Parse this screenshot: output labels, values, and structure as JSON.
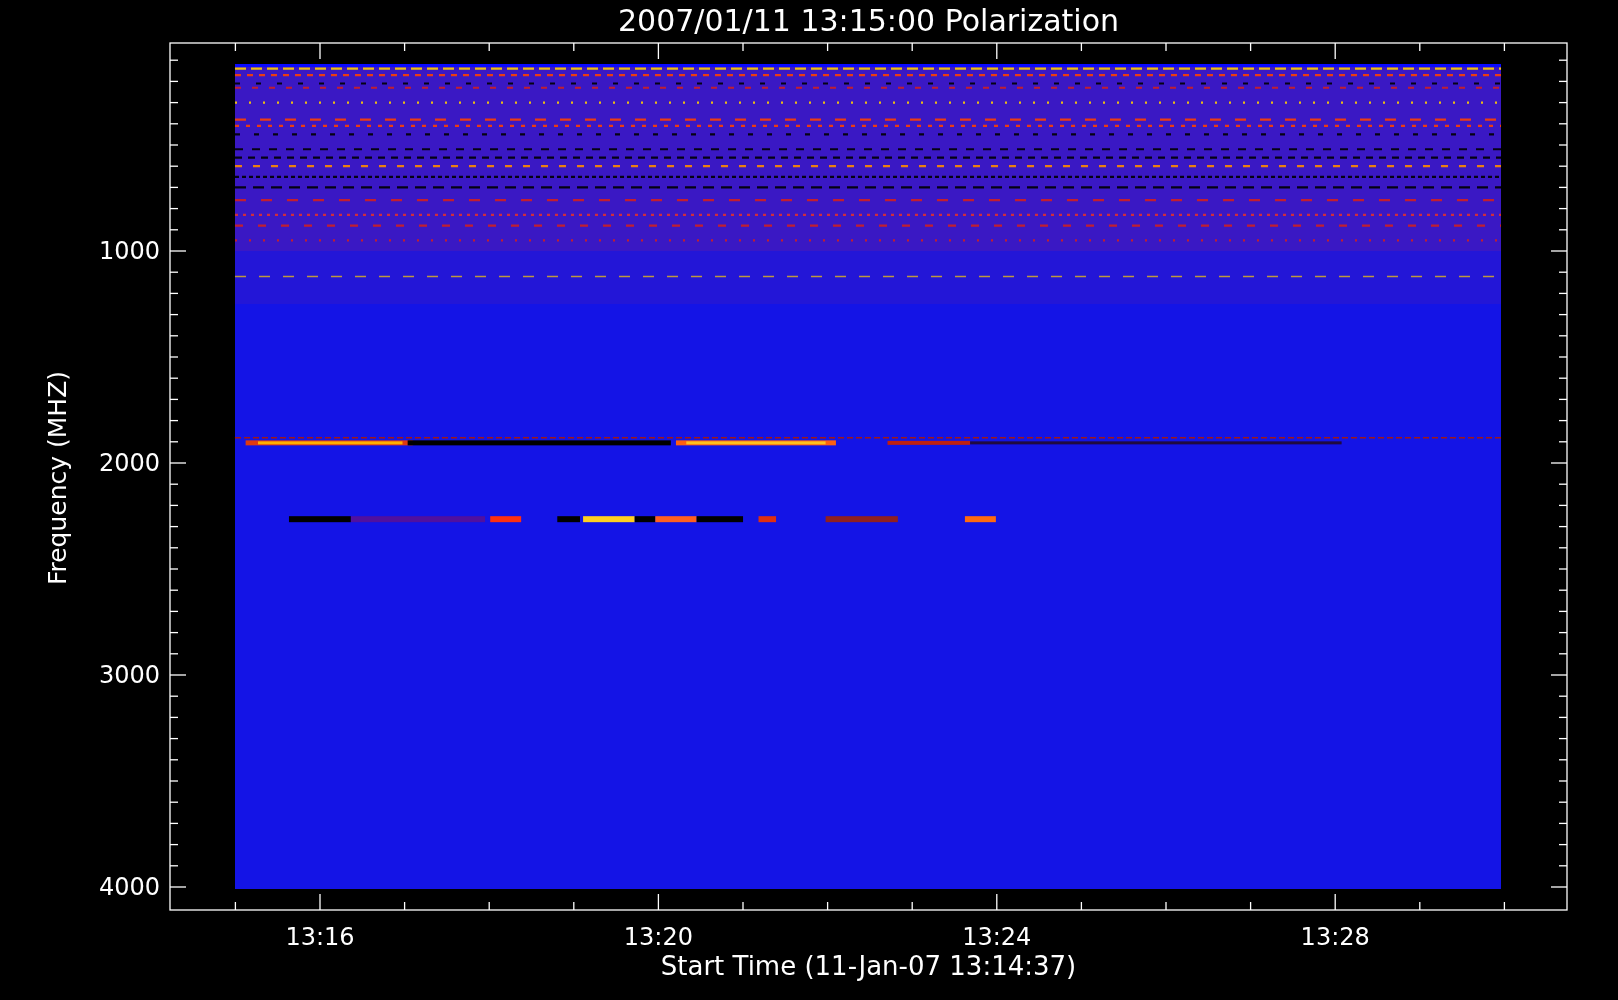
{
  "plot": {
    "title": "2007/01/11 13:15:00 Polarization",
    "x_axis": {
      "title": "Start Time (11-Jan-07 13:14:37)",
      "tick_labels": [
        "13:16",
        "13:20",
        "13:24",
        "13:28"
      ]
    },
    "y_axis": {
      "title": "Frequency (MHZ)",
      "tick_labels": [
        "1000",
        "2000",
        "3000",
        "4000"
      ]
    }
  }
}
